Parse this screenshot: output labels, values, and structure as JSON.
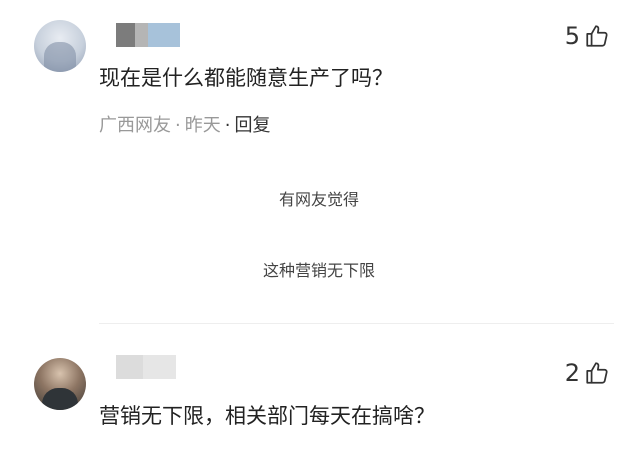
{
  "comments": [
    {
      "likes": "5",
      "text": "现在是什么都能随意生产了吗？",
      "source": "广西网友",
      "time": "昨天",
      "reply_label": "回复"
    },
    {
      "likes": "2",
      "text": "营销无下限，相关部门每天在搞啥？"
    }
  ],
  "center_lines": [
    "有网友觉得",
    "这种营销无下限"
  ],
  "icons": {
    "like": "thumbs-up-icon"
  },
  "colors": {
    "text": "#222222",
    "meta": "#999999",
    "divider": "#eeeeee"
  }
}
